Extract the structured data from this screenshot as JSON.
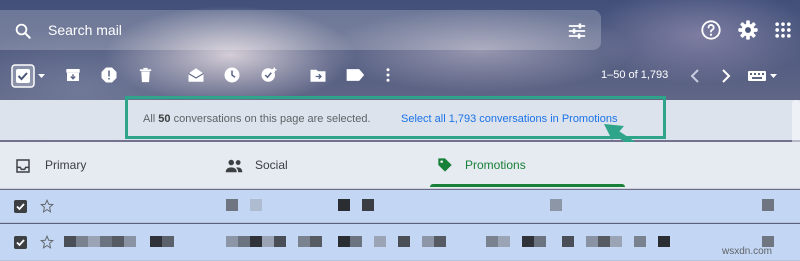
{
  "search": {
    "placeholder": "Search mail"
  },
  "header_icons": [
    "help-icon",
    "settings-gear-icon",
    "apps-grid-icon"
  ],
  "toolbar": {
    "icons": [
      "select-all-checkbox",
      "select-dropdown-icon",
      "archive-icon",
      "report-spam-icon",
      "delete-icon",
      "mark-read-icon",
      "snooze-icon",
      "add-to-tasks-icon",
      "move-to-icon",
      "labels-icon",
      "more-vert-icon"
    ],
    "pagination": "1–50 of 1,793",
    "nav_icons": [
      "prev-page-icon",
      "next-page-icon",
      "input-tools-icon"
    ]
  },
  "selection_banner": {
    "text_prefix": "All ",
    "count": "50",
    "text_suffix": " conversations on this page are selected.",
    "link": "Select all 1,793 conversations in Promotions"
  },
  "tabs": [
    {
      "label": "Primary",
      "icon": "inbox-icon",
      "active": false
    },
    {
      "label": "Social",
      "icon": "people-icon",
      "active": false
    },
    {
      "label": "Promotions",
      "icon": "tag-icon",
      "active": true
    }
  ],
  "colors": {
    "accent_green": "#188038",
    "highlight_border": "#2ea58b",
    "link_blue": "#1a73e8",
    "selected_row": "#c3d6f3"
  },
  "watermark": "wsxdn.com"
}
